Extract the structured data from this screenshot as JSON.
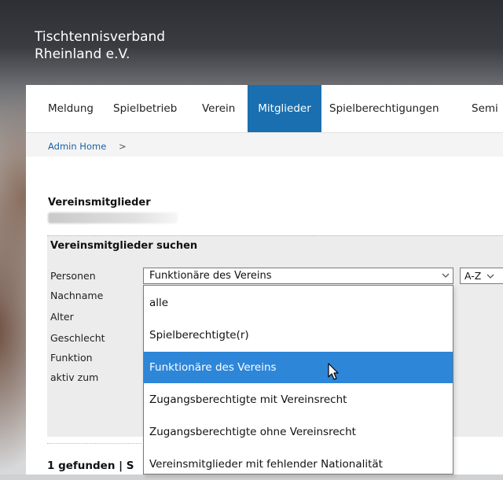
{
  "site": {
    "title_line1": "Tischtennisverband",
    "title_line2": "Rheinland e.V."
  },
  "nav": {
    "items": [
      {
        "label": "Meldung"
      },
      {
        "label": "Spielbetrieb"
      },
      {
        "label": "Verein"
      },
      {
        "label": "Mitglieder",
        "active": true
      },
      {
        "label": "Spielberechtigungen"
      },
      {
        "label": "Semi"
      }
    ]
  },
  "breadcrumb": {
    "home": "Admin Home",
    "separator": ">"
  },
  "page": {
    "heading": "Vereinsmitglieder"
  },
  "search": {
    "title": "Vereinsmitglieder suchen",
    "labels": [
      "Personen",
      "Nachname",
      "Alter",
      "Geschlecht",
      "Funktion",
      "aktiv zum"
    ],
    "personen_selected": "Funktionäre des Vereins",
    "sort_selected": "A-Z",
    "options": [
      "alle",
      "Spielberechtigte(r)",
      "Funktionäre des Vereins",
      "Zugangsberechtigte mit Vereinsrecht",
      "Zugangsberechtigte ohne Vereinsrecht",
      "Vereinsmitglieder mit fehlender Nationalität"
    ],
    "highlighted_index": 2
  },
  "result": {
    "summary": "1 gefunden | S"
  },
  "colors": {
    "nav_active": "#1a6fb0",
    "option_highlight": "#2e86d8",
    "link": "#1a63a8"
  }
}
